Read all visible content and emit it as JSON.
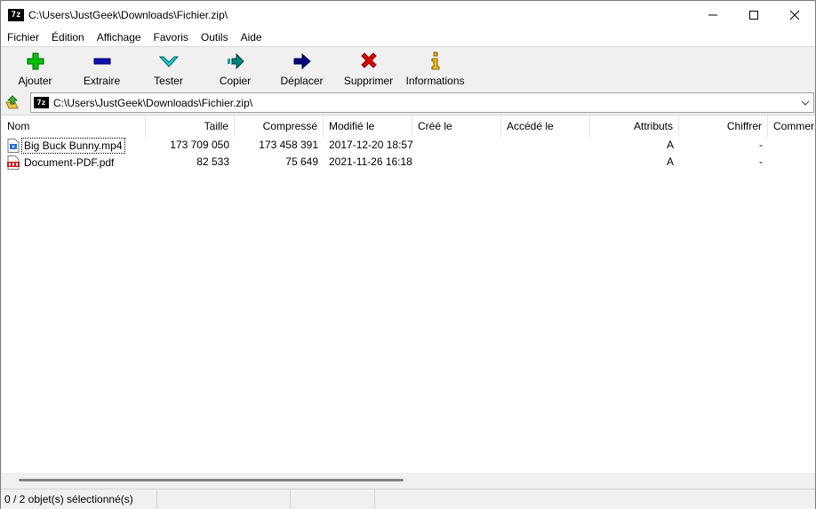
{
  "window": {
    "title": "C:\\Users\\JustGeek\\Downloads\\Fichier.zip\\",
    "logo_text": "7z"
  },
  "menu": [
    "Fichier",
    "Édition",
    "Affichage",
    "Favoris",
    "Outils",
    "Aide"
  ],
  "toolbar": [
    {
      "label": "Ajouter",
      "icon": "plus-icon",
      "color": "#00c000"
    },
    {
      "label": "Extraire",
      "icon": "minus-icon",
      "color": "#0000a0"
    },
    {
      "label": "Tester",
      "icon": "check-icon",
      "color": "#00b0b0"
    },
    {
      "label": "Copier",
      "icon": "copy-arrow-icon",
      "color": "#008080"
    },
    {
      "label": "Déplacer",
      "icon": "move-arrow-icon",
      "color": "#000080"
    },
    {
      "label": "Supprimer",
      "icon": "delete-x-icon",
      "color": "#e00000"
    },
    {
      "label": "Informations",
      "icon": "info-icon",
      "color": "#d0a000"
    }
  ],
  "address": {
    "value": "C:\\Users\\JustGeek\\Downloads\\Fichier.zip\\",
    "logo_text": "7z"
  },
  "columns": [
    "Nom",
    "Taille",
    "Compressé",
    "Modifié le",
    "Créé le",
    "Accédé le",
    "Attributs",
    "Chiffrer",
    "Commer"
  ],
  "files": [
    {
      "name": "Big Buck Bunny.mp4",
      "size": "173 709 050",
      "packed": "173 458 391",
      "modified": "2017-12-20 18:57",
      "created": "",
      "accessed": "",
      "attributes": "A",
      "encrypted": "-",
      "icon": "video-file-icon"
    },
    {
      "name": "Document-PDF.pdf",
      "size": "82 533",
      "packed": "75 649",
      "modified": "2021-11-26 16:18",
      "created": "",
      "accessed": "",
      "attributes": "A",
      "encrypted": "-",
      "icon": "pdf-file-icon"
    }
  ],
  "status": {
    "selection": "0 / 2 objet(s) sélectionné(s)",
    "segment2": "",
    "segment3": "",
    "segment4": ""
  }
}
